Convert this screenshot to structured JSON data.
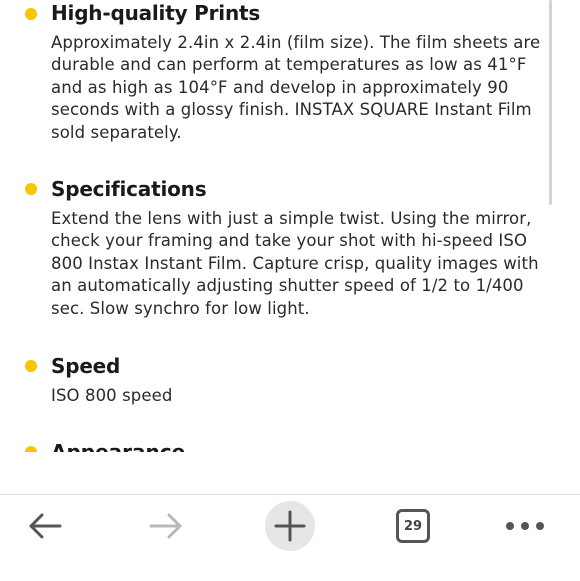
{
  "sections": [
    {
      "heading": "High-quality Prints",
      "body": "Approximately 2.4in x 2.4in (film size). The film sheets are durable and can perform at temperatures as low as 41°F and as high as 104°F and develop in approximately 90 seconds with a glossy finish. INSTAX SQUARE Instant Film sold separately."
    },
    {
      "heading": "Specifications",
      "body": "Extend the lens with just a simple twist. Using the mirror, check your framing and take your shot with hi-speed ISO 800 Instax Instant Film. Capture crisp, quality images with an automatically adjusting shutter speed of 1/2 to 1/400 sec. Slow synchro for low light."
    },
    {
      "heading": "Speed",
      "body": "ISO 800 speed"
    },
    {
      "heading": "Appearance"
    }
  ],
  "toolbar": {
    "back_icon": "arrow-left-icon",
    "forward_icon": "arrow-right-icon",
    "new_tab_icon": "plus-icon",
    "tab_count": "29",
    "menu_icon": "more-horizontal-icon"
  },
  "colors": {
    "bullet": "#f6c600",
    "text": "#1a1a1a",
    "toolbar_icon": "#555555",
    "toolbar_icon_disabled": "#b8b8b8",
    "new_tab_bg": "#e6e6e6"
  }
}
